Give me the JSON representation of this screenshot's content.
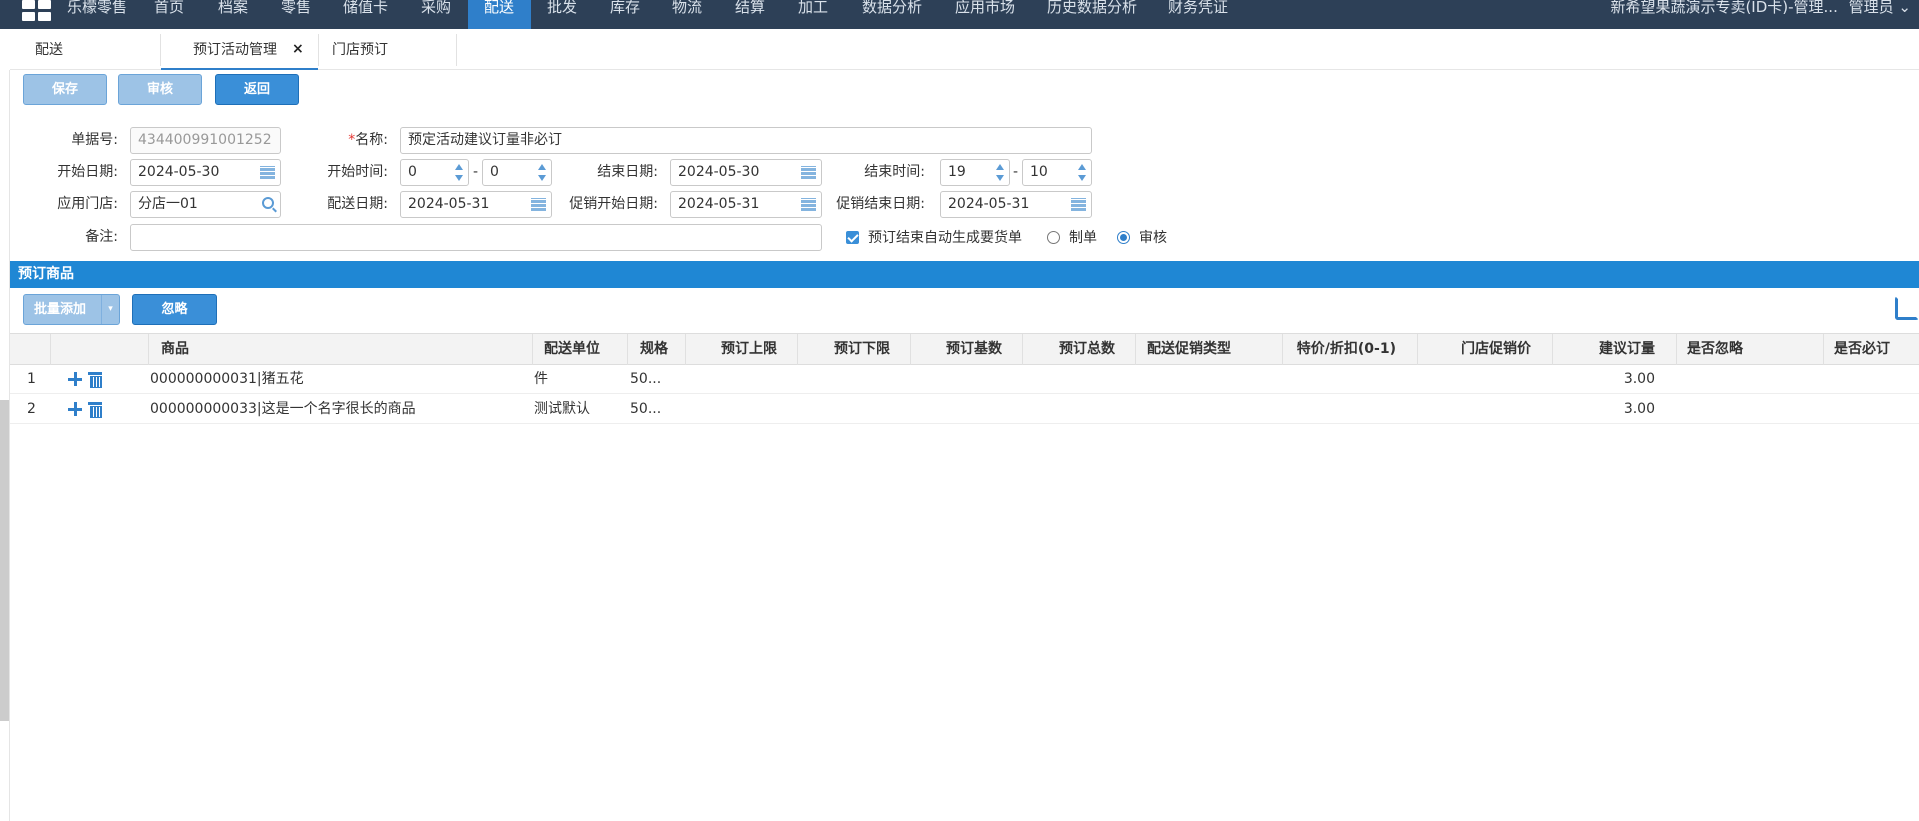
{
  "nav": {
    "brand": "乐檬零售",
    "items": [
      "首页",
      "档案",
      "零售",
      "储值卡",
      "采购",
      "配送",
      "批发",
      "库存",
      "物流",
      "结算",
      "加工",
      "数据分析",
      "应用市场",
      "历史数据分析",
      "财务凭证"
    ],
    "active_item": "配送",
    "account": "新希望果蔬演示专卖(ID卡)-管理...",
    "user": "管理员"
  },
  "tabs": {
    "tab1": "配送",
    "tab2": "预订活动管理",
    "tab2_close": "×",
    "tab3": "门店预订"
  },
  "toolbar": {
    "save": "保存",
    "audit": "审核",
    "back": "返回"
  },
  "form": {
    "order_no_label": "单据号:",
    "order_no": "434400991001252",
    "name_label": "名称:",
    "name_required_mark": "*",
    "name": "预定活动建议订量非必订",
    "start_date_label": "开始日期:",
    "start_date": "2024-05-30",
    "start_time_label": "开始时间:",
    "start_hour": "0",
    "start_minute": "0",
    "end_date_label": "结束日期:",
    "end_date": "2024-05-30",
    "end_time_label": "结束时间:",
    "end_hour": "19",
    "end_minute": "10",
    "time_sep": "-",
    "store_label": "应用门店:",
    "store": "分店一01",
    "delivery_date_label": "配送日期:",
    "delivery_date": "2024-05-31",
    "promo_start_label": "促销开始日期:",
    "promo_start": "2024-05-31",
    "promo_end_label": "促销结束日期:",
    "promo_end": "2024-05-31",
    "remark_label": "备注:",
    "remark": "",
    "auto_generate_label": "预订结束自动生成要货单",
    "auto_generate_checked": true,
    "option_draft": "制单",
    "option_audit": "审核",
    "selected_option": "审核"
  },
  "section": {
    "title": "预订商品",
    "batch_add": "批量添加",
    "ignore": "忽略"
  },
  "table": {
    "columns": [
      "商品",
      "配送单位",
      "规格",
      "预订上限",
      "预订下限",
      "预订基数",
      "预订总数",
      "配送促销类型",
      "特价/折扣(0-1)",
      "门店促销价",
      "建议订量",
      "是否忽略",
      "是否必订"
    ],
    "rows": [
      {
        "index": "1",
        "product": "000000000031|猪五花",
        "unit": "件",
        "spec": "50...",
        "suggested": "3.00"
      },
      {
        "index": "2",
        "product": "000000000033|这是一个名字很长的商品",
        "unit": "测试默认",
        "spec": "50...",
        "suggested": "3.00"
      }
    ]
  },
  "colors": {
    "nav_bg": "#2d4057",
    "nav_active": "#2f7fca",
    "section_bar": "#1f87d4",
    "accent": "#2f7fca"
  }
}
